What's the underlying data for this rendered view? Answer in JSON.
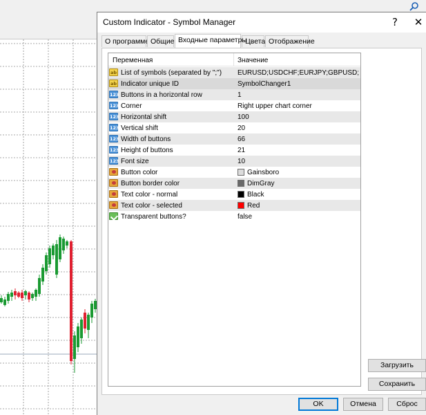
{
  "window": {
    "title": "Custom Indicator - Symbol Manager",
    "help_glyph": "?",
    "close_glyph": "✕"
  },
  "tabs": [
    {
      "label": "О программе",
      "active": false
    },
    {
      "label": "Общие",
      "active": false
    },
    {
      "label": "Входные параметры",
      "active": true
    },
    {
      "label": "Цвета",
      "active": false
    },
    {
      "label": "Отображение",
      "active": false
    }
  ],
  "grid": {
    "header_variable": "Переменная",
    "header_value": "Значение",
    "rows": [
      {
        "icon": "string-icon",
        "label": "List of symbols (separated by \";\")",
        "value": "EURUSD;USDCHF;EURJPY;GBPUSD;GBP...",
        "swatch": null
      },
      {
        "icon": "string-icon",
        "label": "Indicator unique ID",
        "value": "SymbolChanger1",
        "swatch": null
      },
      {
        "icon": "integer-icon",
        "label": "Buttons in a horizontal row",
        "value": "1",
        "swatch": null
      },
      {
        "icon": "integer-icon",
        "label": "Corner",
        "value": "Right upper chart corner",
        "swatch": null
      },
      {
        "icon": "integer-icon",
        "label": "Horizontal shift",
        "value": "100",
        "swatch": null
      },
      {
        "icon": "integer-icon",
        "label": "Vertical shift",
        "value": "20",
        "swatch": null
      },
      {
        "icon": "integer-icon",
        "label": "Width of buttons",
        "value": "66",
        "swatch": null
      },
      {
        "icon": "integer-icon",
        "label": "Height of buttons",
        "value": "21",
        "swatch": null
      },
      {
        "icon": "integer-icon",
        "label": "Font size",
        "value": "10",
        "swatch": null
      },
      {
        "icon": "color-icon",
        "label": "Button color",
        "value": "Gainsboro",
        "swatch": "#DCDCDC"
      },
      {
        "icon": "color-icon",
        "label": "Button border color",
        "value": "DimGray",
        "swatch": "#696969"
      },
      {
        "icon": "color-icon",
        "label": "Text color - normal",
        "value": "Black",
        "swatch": "#000000"
      },
      {
        "icon": "color-icon",
        "label": "Text color - selected",
        "value": "Red",
        "swatch": "#FF0000"
      },
      {
        "icon": "bool-icon",
        "label": "Transparent buttons?",
        "value": "false",
        "swatch": null
      }
    ]
  },
  "buttons": {
    "load": "Загрузить",
    "save": "Сохранить",
    "ok": "OK",
    "cancel": "Отмена",
    "reset": "Сброс"
  },
  "colors": {
    "bull_candle": "#1a9a32",
    "bear_candle": "#e02030",
    "grid_line": "#8a8a8a",
    "ok_border": "#0078d7"
  }
}
